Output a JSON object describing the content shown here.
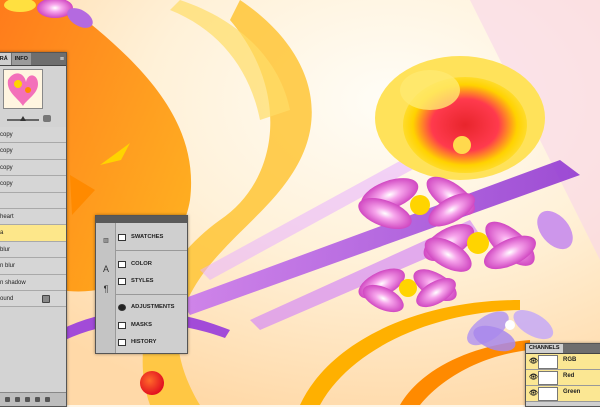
{
  "layers_panel": {
    "tabs": [
      "IGRÁ",
      "INFO"
    ],
    "layers": [
      {
        "name": "copy",
        "selected": false
      },
      {
        "name": "copy",
        "selected": false
      },
      {
        "name": "copy",
        "selected": false
      },
      {
        "name": "copy",
        "selected": false
      },
      {
        "name": "",
        "selected": false
      },
      {
        "name": "heart",
        "selected": false
      },
      {
        "name": "a",
        "selected": true
      },
      {
        "name": "blur",
        "selected": false
      },
      {
        "name": "n blur",
        "selected": false
      },
      {
        "name": "n shadow",
        "selected": false
      },
      {
        "name": "ound",
        "selected": false,
        "locked": true
      }
    ]
  },
  "floating_panel": {
    "items": [
      {
        "icon": "swatches-icon",
        "label": "SWATCHES"
      },
      {
        "icon": "color-icon",
        "label": "COLOR"
      },
      {
        "icon": "styles-icon",
        "label": "STYLES"
      },
      {
        "icon": "adjustments-icon",
        "label": "ADJUSTMENTS"
      },
      {
        "icon": "masks-icon",
        "label": "MASKS"
      },
      {
        "icon": "history-icon",
        "label": "HISTORY"
      }
    ],
    "side_icons": [
      "histogram-icon",
      "character-icon",
      "paragraph-icon"
    ]
  },
  "channels_panel": {
    "tab": "CHANNELS",
    "channels": [
      {
        "name": "RGB"
      },
      {
        "name": "Red"
      },
      {
        "name": "Green"
      }
    ]
  },
  "colors": {
    "accent_orange": "#ff8a00",
    "accent_purple": "#b34fe0",
    "accent_pink": "#f04fb0",
    "yellow": "#ffd400",
    "panel_grey": "#cfcfcf",
    "selected_row": "#fde78a"
  }
}
